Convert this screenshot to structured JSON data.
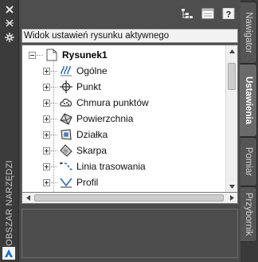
{
  "palette": {
    "title_panel": "#3b3b3b",
    "panel_bg": "#4a4a4a",
    "tab_active": "#6a6a6a",
    "tab_inactive": "#555555"
  },
  "left_bar": {
    "title": "OBSZAR NARZĘDZI",
    "buttons": [
      {
        "name": "close-icon"
      },
      {
        "name": "auto-hide-icon"
      },
      {
        "name": "properties-icon"
      }
    ]
  },
  "toolbar": {
    "icons": [
      "tree-view-icon",
      "item-view-icon",
      "help-icon"
    ]
  },
  "view_dropdown": {
    "value": "Widok ustawień rysunku aktywnego"
  },
  "tree": {
    "root": {
      "label": "Rysunek1",
      "icon": "drawing-icon"
    },
    "items": [
      {
        "label": "Ogólne",
        "icon": "general-icon"
      },
      {
        "label": "Punkt",
        "icon": "point-icon"
      },
      {
        "label": "Chmura punktów",
        "icon": "point-cloud-icon"
      },
      {
        "label": "Powierzchnia",
        "icon": "surface-icon"
      },
      {
        "label": "Działka",
        "icon": "parcel-icon"
      },
      {
        "label": "Skarpa",
        "icon": "grading-icon"
      },
      {
        "label": "Linia trasowania",
        "icon": "alignment-icon"
      },
      {
        "label": "Profil",
        "icon": "profile-icon"
      }
    ]
  },
  "tabs": [
    {
      "label": "Nawigator",
      "active": false
    },
    {
      "label": "Ustawienia",
      "active": true
    },
    {
      "label": "Pomiar",
      "active": false
    },
    {
      "label": "Przybornik",
      "active": false
    }
  ]
}
